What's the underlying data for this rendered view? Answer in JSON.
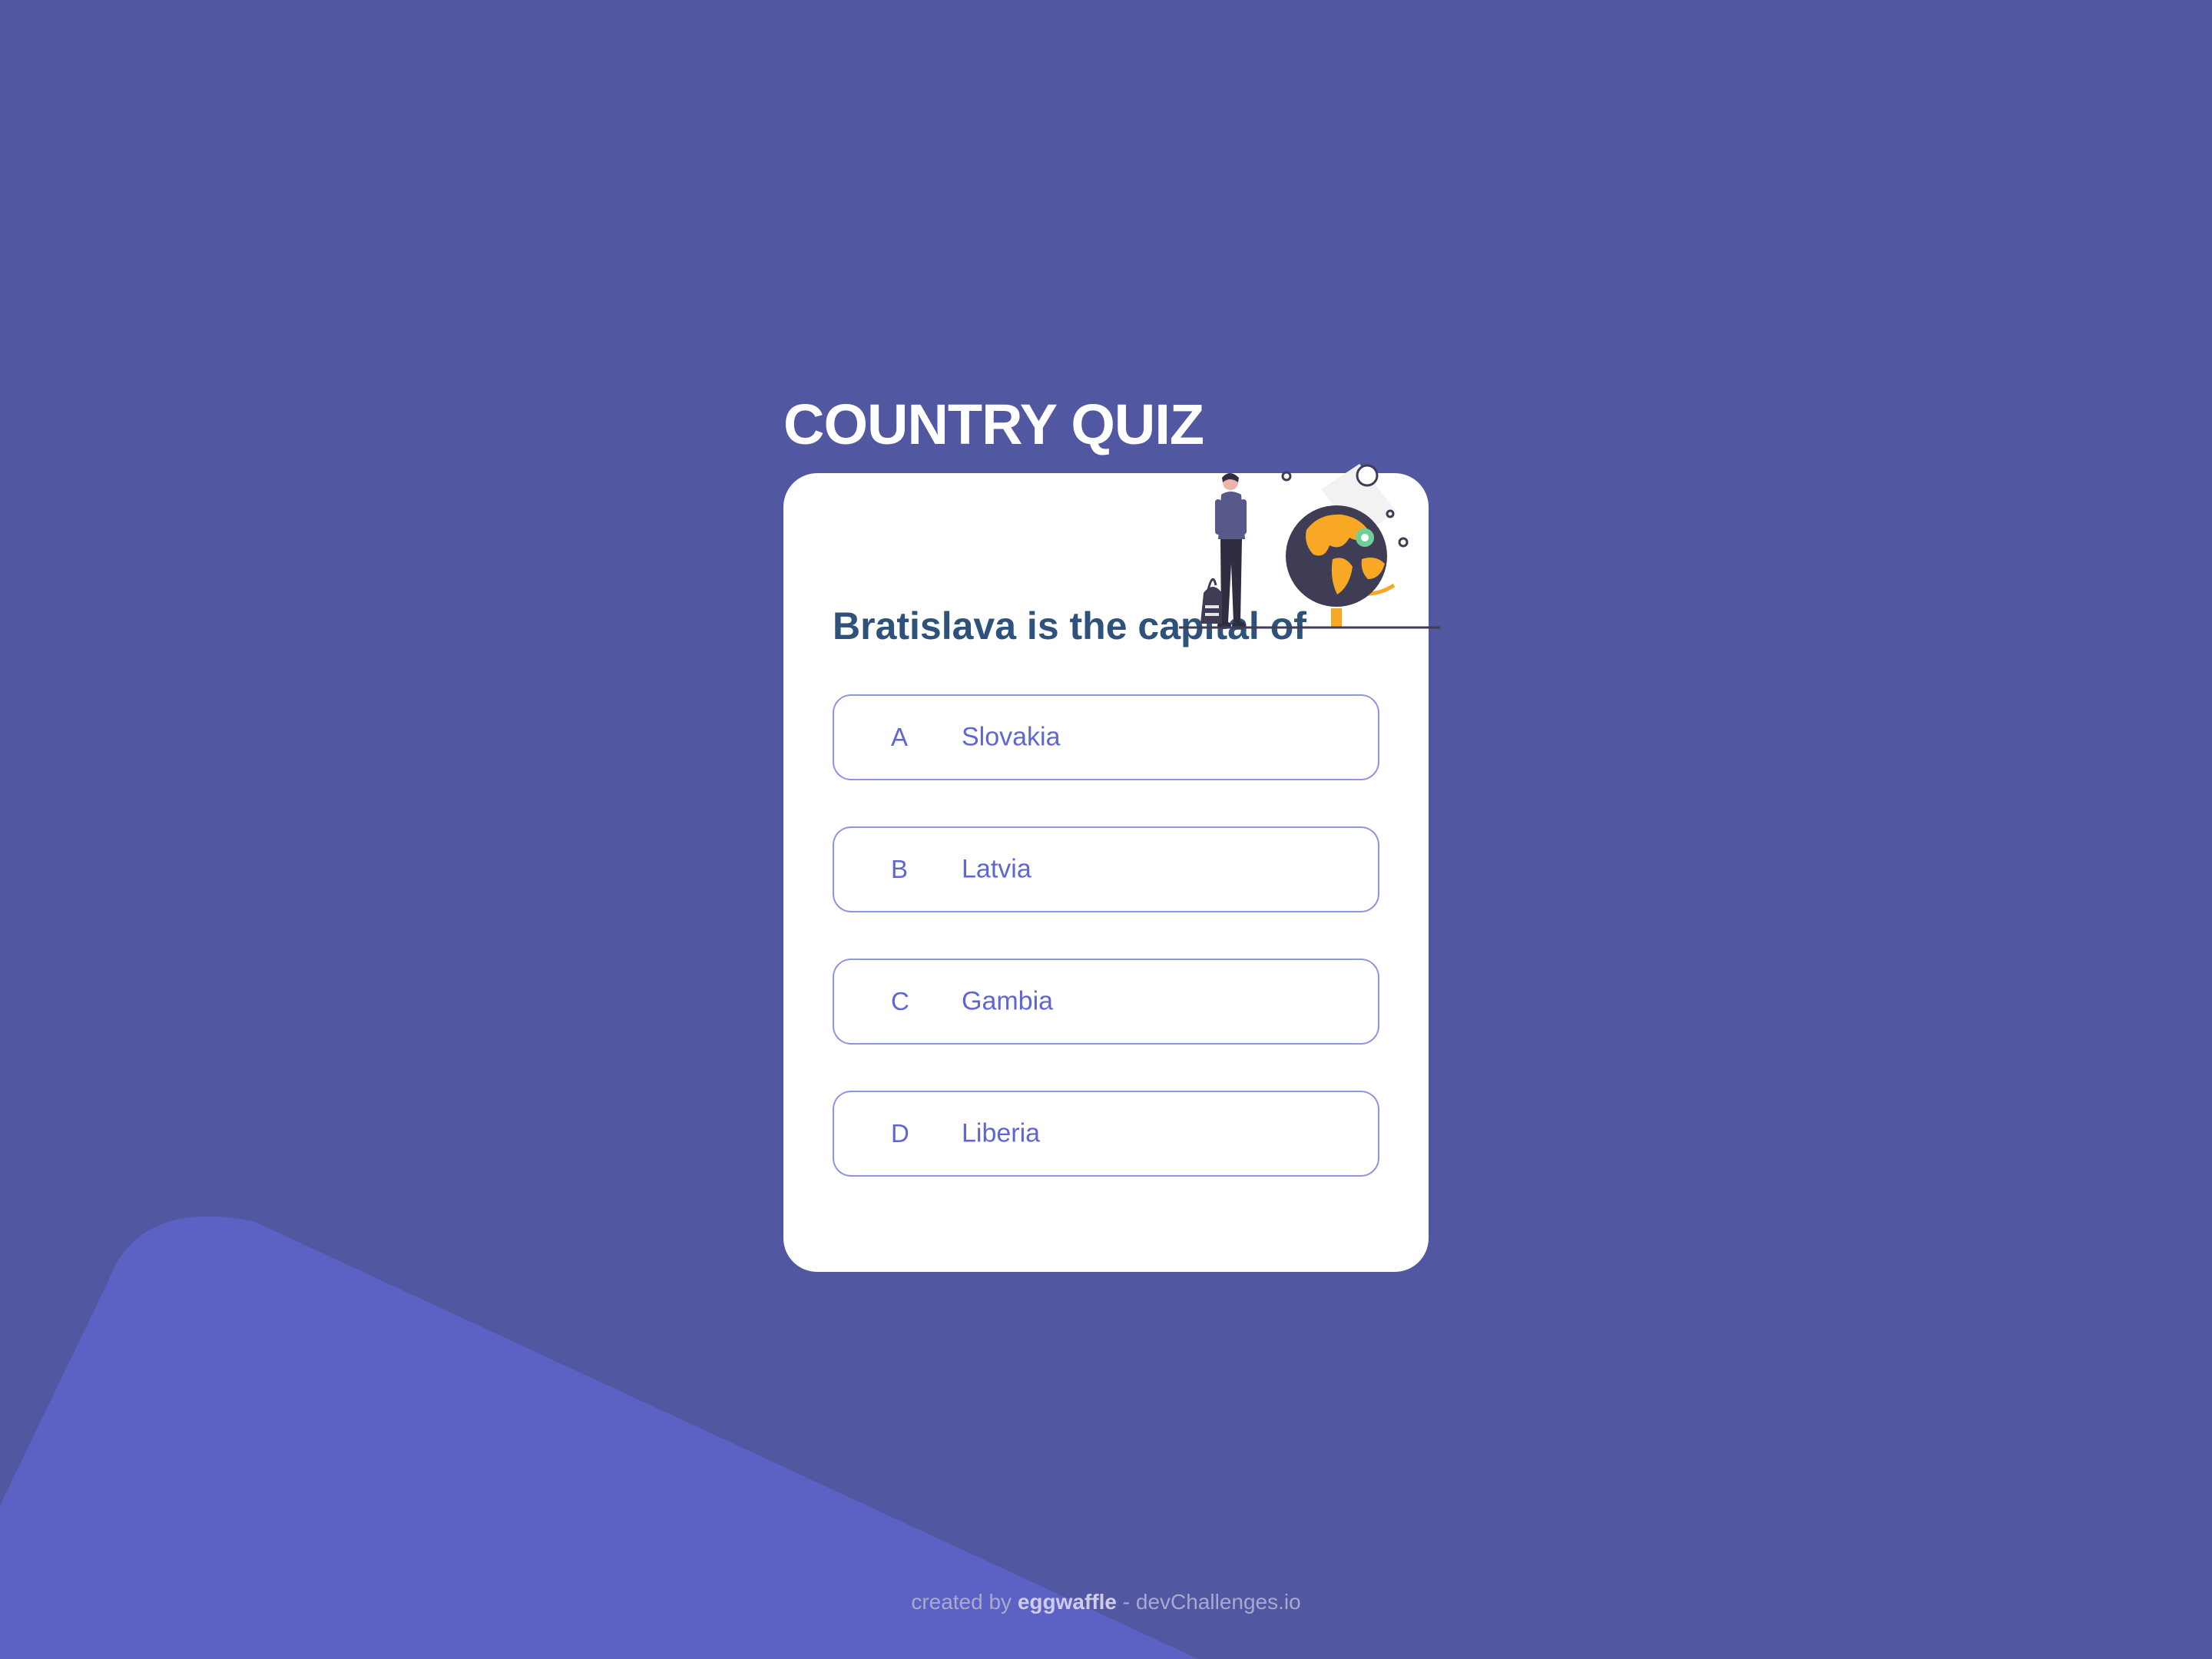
{
  "colors": {
    "background": "#5157a1",
    "background_shape": "#5c62c3",
    "title": "#ffffff",
    "card": "#ffffff",
    "question": "#2f527b",
    "option_accent": "#6066d0",
    "illustration_globe": "#f9a826",
    "illustration_dark": "#3f3d56"
  },
  "quiz": {
    "title": "COUNTRY QUIZ",
    "illustration_icon": "traveler-globe-illustration",
    "question": "Bratislava is the capital of",
    "options": [
      {
        "letter": "A",
        "text": "Slovakia"
      },
      {
        "letter": "B",
        "text": "Latvia"
      },
      {
        "letter": "C",
        "text": "Gambia"
      },
      {
        "letter": "D",
        "text": "Liberia"
      }
    ]
  },
  "footer": {
    "prefix": "created by",
    "author": "eggwaffle",
    "suffix": "- devChallenges.io"
  }
}
